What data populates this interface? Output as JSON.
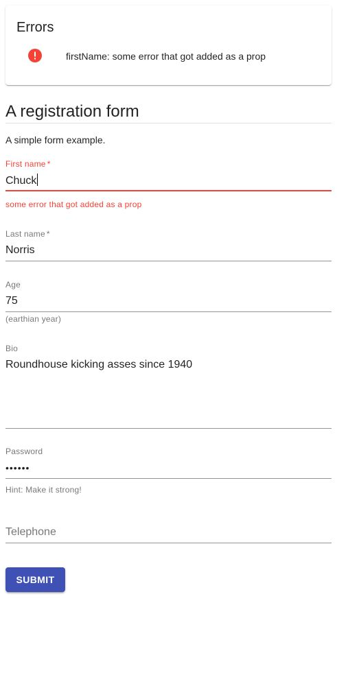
{
  "errors": {
    "title": "Errors",
    "items": [
      {
        "icon": "error-icon",
        "text": "firstName: some error that got added as a prop"
      }
    ]
  },
  "form": {
    "title": "A registration form",
    "description": "A simple form example."
  },
  "fields": {
    "first_name": {
      "label": "First name",
      "required_mark": "*",
      "value": "Chuck",
      "error": "some error that got added as a prop"
    },
    "last_name": {
      "label": "Last name",
      "required_mark": "*",
      "value": "Norris"
    },
    "age": {
      "label": "Age",
      "value": "75",
      "helper": "(earthian year)"
    },
    "bio": {
      "label": "Bio",
      "value": "Roundhouse kicking asses since 1940"
    },
    "password": {
      "label": "Password",
      "value": "••••••",
      "helper": "Hint: Make it strong!"
    },
    "telephone": {
      "label": "Telephone",
      "value": ""
    }
  },
  "submit": {
    "label": "SUBMIT"
  },
  "colors": {
    "error": "#f44336",
    "primary": "#3f51b5"
  }
}
